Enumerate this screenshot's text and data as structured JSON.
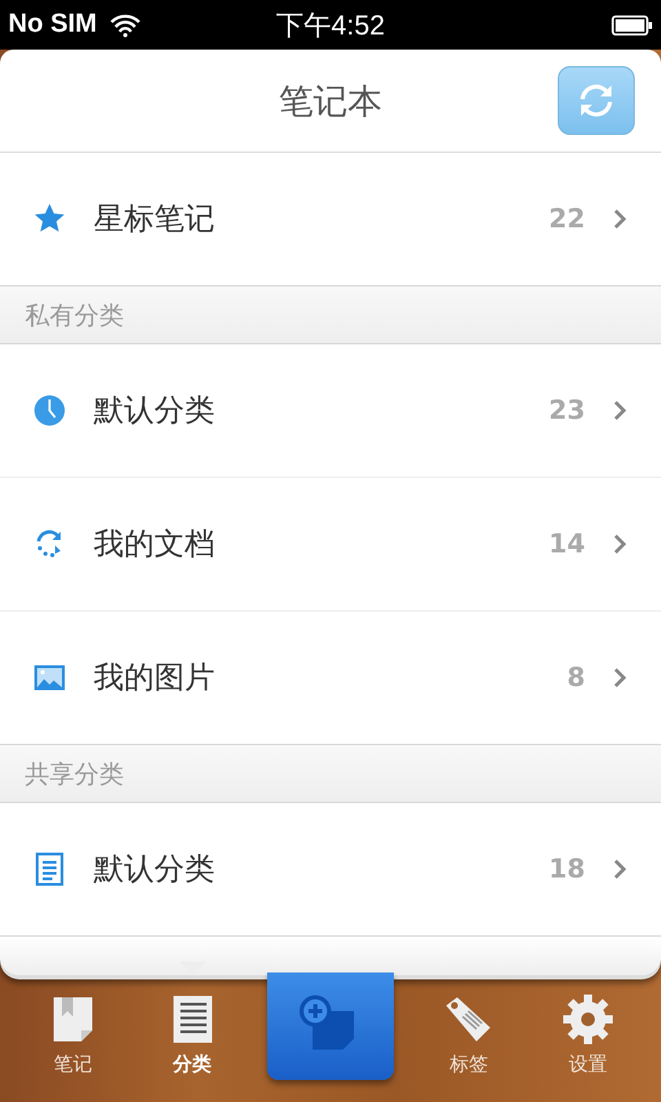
{
  "status_bar": {
    "carrier": "No SIM",
    "time": "下午4:52"
  },
  "header": {
    "title": "笔记本"
  },
  "starred": {
    "kind": "star",
    "label": "星标笔记",
    "count": "22"
  },
  "sections": [
    {
      "title": "私有分类",
      "items": [
        {
          "kind": "clock",
          "label": "默认分类",
          "count": "23"
        },
        {
          "kind": "sync",
          "label": "我的文档",
          "count": "14"
        },
        {
          "kind": "image",
          "label": "我的图片",
          "count": "8"
        }
      ]
    },
    {
      "title": "共享分类",
      "items": [
        {
          "kind": "document",
          "label": "默认分类",
          "count": "18"
        }
      ]
    }
  ],
  "tab_bar": [
    {
      "kind": "notes",
      "label": "笔记",
      "selected": false
    },
    {
      "kind": "categories",
      "label": "分类",
      "selected": true
    },
    {
      "kind": "compose"
    },
    {
      "kind": "tags",
      "label": "标签",
      "selected": false
    },
    {
      "kind": "settings",
      "label": "设置",
      "selected": false
    }
  ]
}
